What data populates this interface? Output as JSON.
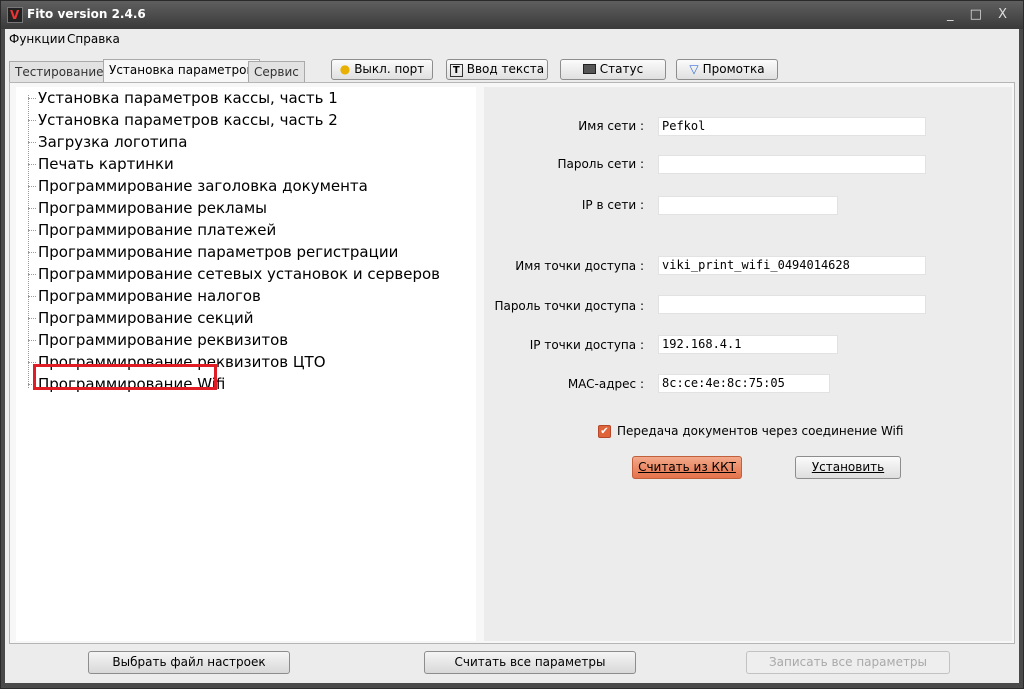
{
  "window": {
    "title": "Fito version 2.4.6",
    "controls": "_ □ X"
  },
  "menu": [
    "Функции",
    "Справка"
  ],
  "tabs": [
    "Тестирование",
    "Установка параметров",
    "Сервис"
  ],
  "toolbar": {
    "port": "Выкл. порт",
    "text_input": "Ввод текста",
    "status": "Статус",
    "feed": "Промотка"
  },
  "tree": {
    "items": [
      "Установка параметров кассы, часть 1",
      "Установка параметров кассы, часть 2",
      "Загрузка логотипа",
      "Печать картинки",
      "Программирование заголовка документа",
      "Программирование рекламы",
      "Программирование платежей",
      "Программирование параметров регистрации",
      "Программирование сетевых установок и серверов",
      "Программирование налогов",
      "Программирование секций",
      "Программирование реквизитов",
      "Программирование реквизитов ЦТО",
      "Программирование Wifi"
    ],
    "selected_index": 13
  },
  "form": {
    "network_name_label": "Имя сети :",
    "network_name_value": "Pefkol",
    "network_password_label": "Пароль сети :",
    "network_password_value": "",
    "ip_in_network_label": "IP в сети :",
    "access_point_name_label": "Имя точки доступа :",
    "access_point_name_value": "viki_print_wifi_0494014628",
    "access_point_password_label": "Пароль точки доступа :",
    "access_point_password_value": "",
    "access_point_ip_label": "IP точки доступа :",
    "access_point_ip_value": "192.168.4.1",
    "mac_label": "MAC-адрес :",
    "mac_value": "8c:ce:4e:8c:75:05",
    "transfer_checkbox_label": "Передача документов через соединение Wifi",
    "transfer_checked": true,
    "read_button": "Считать из ККТ",
    "set_button": "Установить"
  },
  "bottom": {
    "choose_file": "Выбрать файл настроек",
    "read_all": "Считать все параметры",
    "write_all": "Записать все параметры"
  },
  "colors": {
    "selection_frame": "#e01c24",
    "accent_button": "#e5724a"
  }
}
